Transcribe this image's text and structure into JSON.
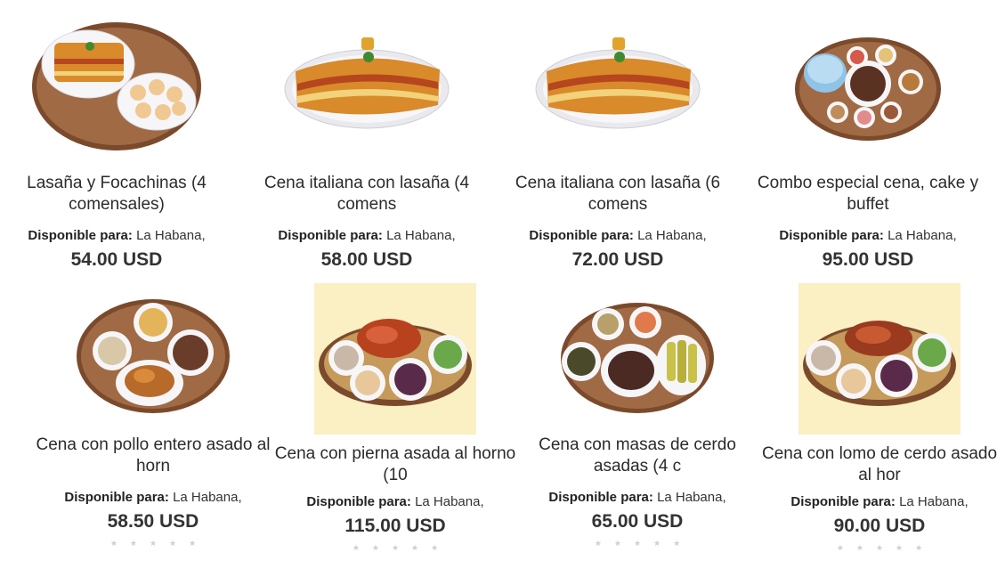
{
  "products": [
    {
      "title": "Lasaña y Focachinas (4 comensales)",
      "avail_label": "Disponible para:",
      "avail_value": "La Habana,",
      "price": "54.00 USD",
      "image": "lasagna-and-focaccia-plate"
    },
    {
      "title": "Cena italiana con lasaña (4 comens",
      "avail_label": "Disponible para:",
      "avail_value": "La Habana,",
      "price": "58.00 USD",
      "image": "lasagna-plate"
    },
    {
      "title": "Cena italiana con lasaña (6 comens",
      "avail_label": "Disponible para:",
      "avail_value": "La Habana,",
      "price": "72.00 USD",
      "image": "lasagna-plate"
    },
    {
      "title": "Combo especial cena, cake y buffet",
      "avail_label": "Disponible para:",
      "avail_value": "La Habana,",
      "price": "95.00 USD",
      "image": "cake-and-buffet-platter"
    },
    {
      "title": "Cena con pollo entero asado al horn",
      "avail_label": "Disponible para:",
      "avail_value": "La Habana,",
      "price": "58.50 USD",
      "image": "roast-chicken-platter"
    },
    {
      "title": "Cena con pierna asada al horno (10",
      "avail_label": "Disponible para:",
      "avail_value": "La Habana,",
      "price": "115.00 USD",
      "image": "roast-leg-platter"
    },
    {
      "title": "Cena con masas de cerdo asadas (4 c",
      "avail_label": "Disponible para:",
      "avail_value": "La Habana,",
      "price": "65.00 USD",
      "image": "pork-chunks-platter"
    },
    {
      "title": "Cena con lomo de cerdo asado al hor",
      "avail_label": "Disponible para:",
      "avail_value": "La Habana,",
      "price": "90.00 USD",
      "image": "pork-loin-platter"
    }
  ],
  "colors": {
    "wood": "#8a5a3a",
    "plate": "#f4f4f6",
    "lasagna": "#d98a2b",
    "sauce": "#b5461e",
    "cream_bg": "#fbefc4",
    "star": "#cfcfcf"
  }
}
